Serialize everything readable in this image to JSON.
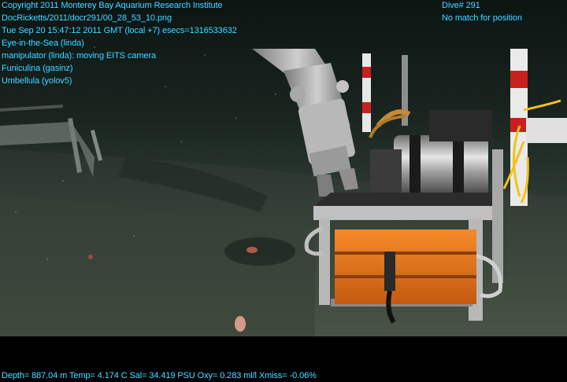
{
  "overlay": {
    "top_left": [
      "Copyright 2011 Monterey Bay Aquarium Research Institute",
      "DocRicketts/2011/docr291/00_28_53_10.png",
      "Tue Sep 20 15:47:12 2011 GMT (local +7)  esecs=1316533632",
      "Eye-in-the-Sea (linda)",
      "manipulator (linda): moving EITS camera",
      "Funiculina (gasinz)",
      "Umbellula (yolov5)"
    ],
    "top_right": [
      "Dive# 291",
      "No match for position"
    ],
    "bottom": "Depth= 887.04 m  Temp= 4.174 C  Sal= 34.419 PSU  Oxy= 0.283 ml/l  Xmiss= -0.06%"
  },
  "colors": {
    "overlay_text": "#3fe4ff",
    "frame_orange": "#f07a1e",
    "housing_steel": "#c9c9c9",
    "cable_yellow": "#f3c21a"
  }
}
